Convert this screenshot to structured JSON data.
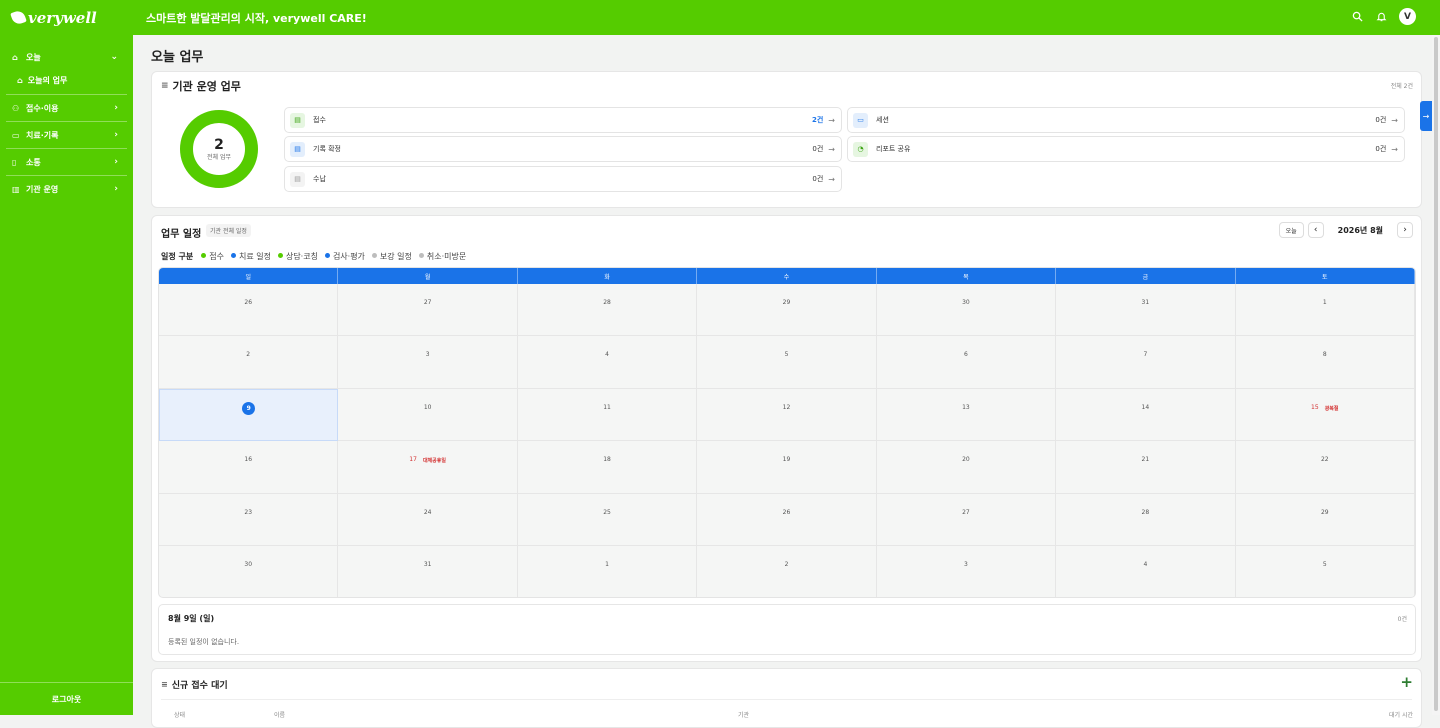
{
  "brand": {
    "logo": "verywell",
    "slogan": "스마트한 발달관리의 시작, verywell CARE!"
  },
  "topbar": {
    "avatar": "V"
  },
  "sidebar": {
    "items": [
      {
        "label": "오늘"
      },
      {
        "label": "오늘의 업무"
      },
      {
        "label": "접수·이용"
      },
      {
        "label": "치료·기록"
      },
      {
        "label": "소통"
      },
      {
        "label": "기관 운영"
      }
    ],
    "logout": "로그아웃"
  },
  "page": {
    "title": "오늘 업무"
  },
  "ops": {
    "title": "기관 운영 업무",
    "total": "전체 2건",
    "donut": {
      "value": "2",
      "label": "전체 업무"
    },
    "tasks": [
      {
        "label": "접수",
        "count": "2건"
      },
      {
        "label": "세션",
        "count": "0건"
      },
      {
        "label": "기록 확정",
        "count": "0건"
      },
      {
        "label": "리포트 공유",
        "count": "0건"
      },
      {
        "label": "수납",
        "count": "0건"
      }
    ]
  },
  "schedule": {
    "title": "업무 일정",
    "subtitle": "기관 전체 일정",
    "today_button": "오늘",
    "month": "2026년 8월",
    "legend_title": "일정 구분",
    "legend": [
      {
        "label": "접수",
        "color": "#55cc00"
      },
      {
        "label": "치료 일정",
        "color": "#1a73e8"
      },
      {
        "label": "상담·코칭",
        "color": "#55cc00"
      },
      {
        "label": "검사·평가",
        "color": "#1a73e8"
      },
      {
        "label": "보강 일정",
        "color": "#bdbdbd"
      },
      {
        "label": "취소·미방문",
        "color": "#bdbdbd"
      }
    ],
    "weekdays": [
      "일",
      "월",
      "화",
      "수",
      "목",
      "금",
      "토"
    ],
    "days": [
      "26",
      "27",
      "28",
      "29",
      "30",
      "31",
      "1",
      "2",
      "3",
      "4",
      "5",
      "6",
      "7",
      "8",
      "9",
      "10",
      "11",
      "12",
      "13",
      "14",
      "15",
      "16",
      "17",
      "18",
      "19",
      "20",
      "21",
      "22",
      "23",
      "24",
      "25",
      "26",
      "27",
      "28",
      "29",
      "30",
      "31",
      "1",
      "2",
      "3",
      "4",
      "5"
    ],
    "holidays": {
      "15": "광복절",
      "17": "대체공휴일"
    },
    "detail": {
      "title": "8월 9일 (일)",
      "count": "0건",
      "empty": "등록된 일정이 없습니다."
    }
  },
  "intake": {
    "title": "신규 접수 대기",
    "columns": [
      "상태",
      "이름",
      "기관",
      "대기 시간"
    ]
  }
}
